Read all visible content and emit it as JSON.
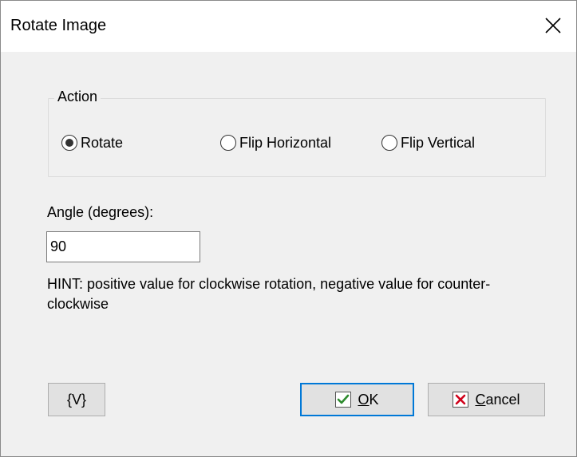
{
  "window": {
    "title": "Rotate Image"
  },
  "action_group": {
    "legend": "Action",
    "options": [
      {
        "label": "Rotate",
        "checked": true
      },
      {
        "label": "Flip Horizontal",
        "checked": false
      },
      {
        "label": "Flip Vertical",
        "checked": false
      }
    ]
  },
  "angle": {
    "label": "Angle (degrees):",
    "value": "90"
  },
  "hint": {
    "text": "HINT: positive value for clockwise rotation, negative value for counter-clockwise"
  },
  "buttons": {
    "variables_label": "{V}",
    "ok_label": "OK",
    "cancel_label": "Cancel"
  },
  "colors": {
    "accent": "#0078d7",
    "ok_check": "#2e8b2e",
    "cancel_x": "#d0021b"
  }
}
